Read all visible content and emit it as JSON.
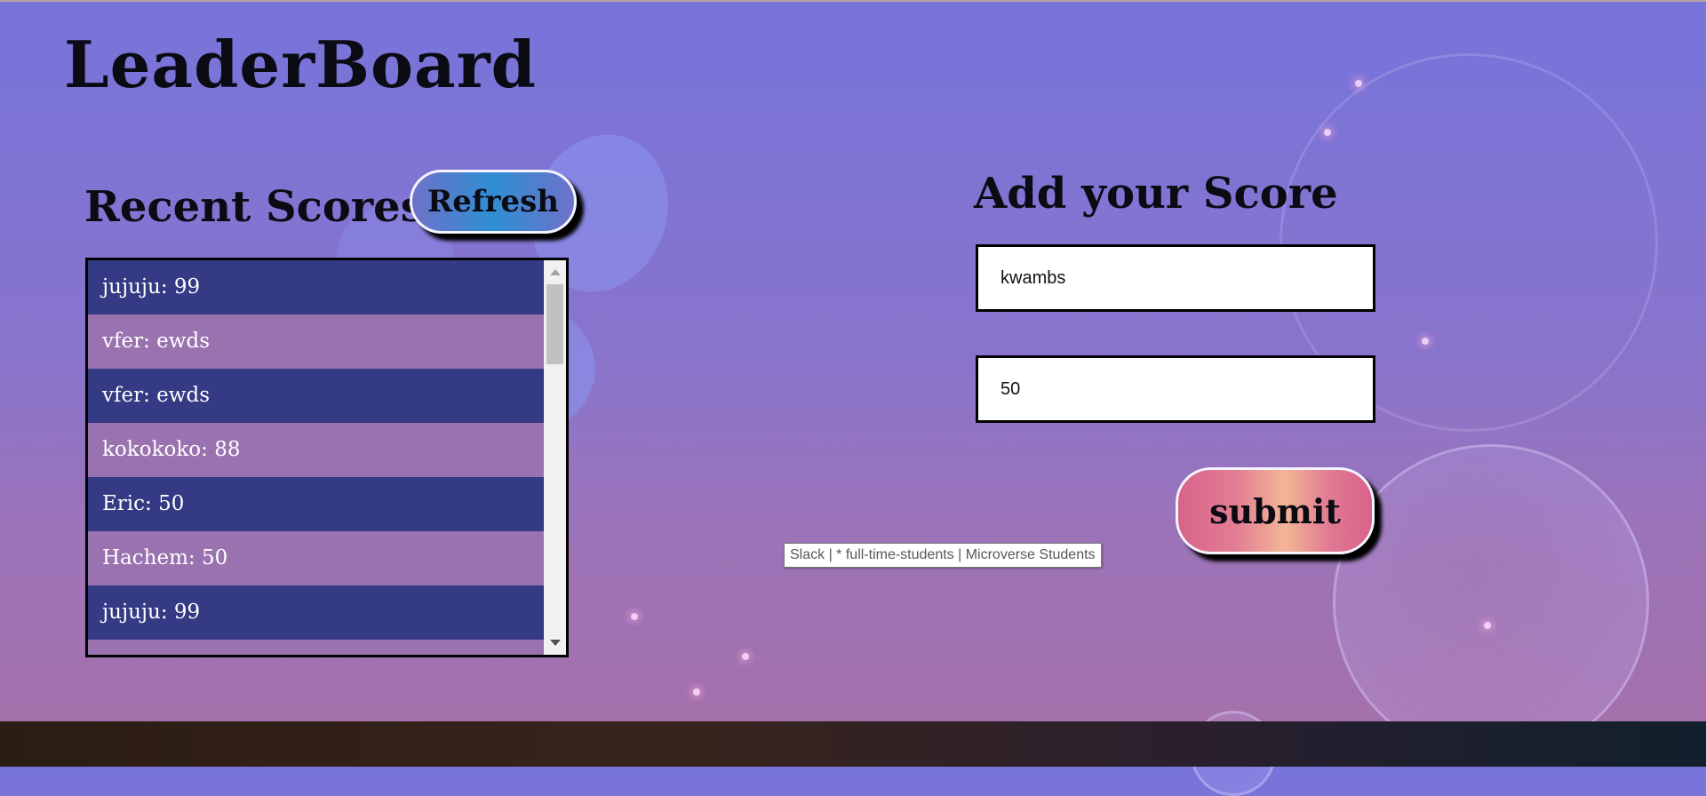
{
  "page": {
    "title": "LeaderBoard"
  },
  "recent_scores": {
    "title": "Recent Scores",
    "refresh_label": "Refresh",
    "items": [
      {
        "text": "jujuju: 99"
      },
      {
        "text": "vfer: ewds"
      },
      {
        "text": "vfer: ewds"
      },
      {
        "text": "kokokoko: 88"
      },
      {
        "text": "Eric: 50"
      },
      {
        "text": "Hachem: 50"
      },
      {
        "text": "jujuju: 99"
      }
    ]
  },
  "add_score": {
    "title": "Add your Score",
    "name_value": "kwambs",
    "score_value": "50",
    "submit_label": "submit"
  },
  "tooltip": {
    "text": "Slack | * full-time-students | Microverse Students"
  },
  "colors": {
    "row_dark": "#343a84",
    "refresh_gradient": "#2f8ed3",
    "submit_gradient": "#f3b596"
  }
}
